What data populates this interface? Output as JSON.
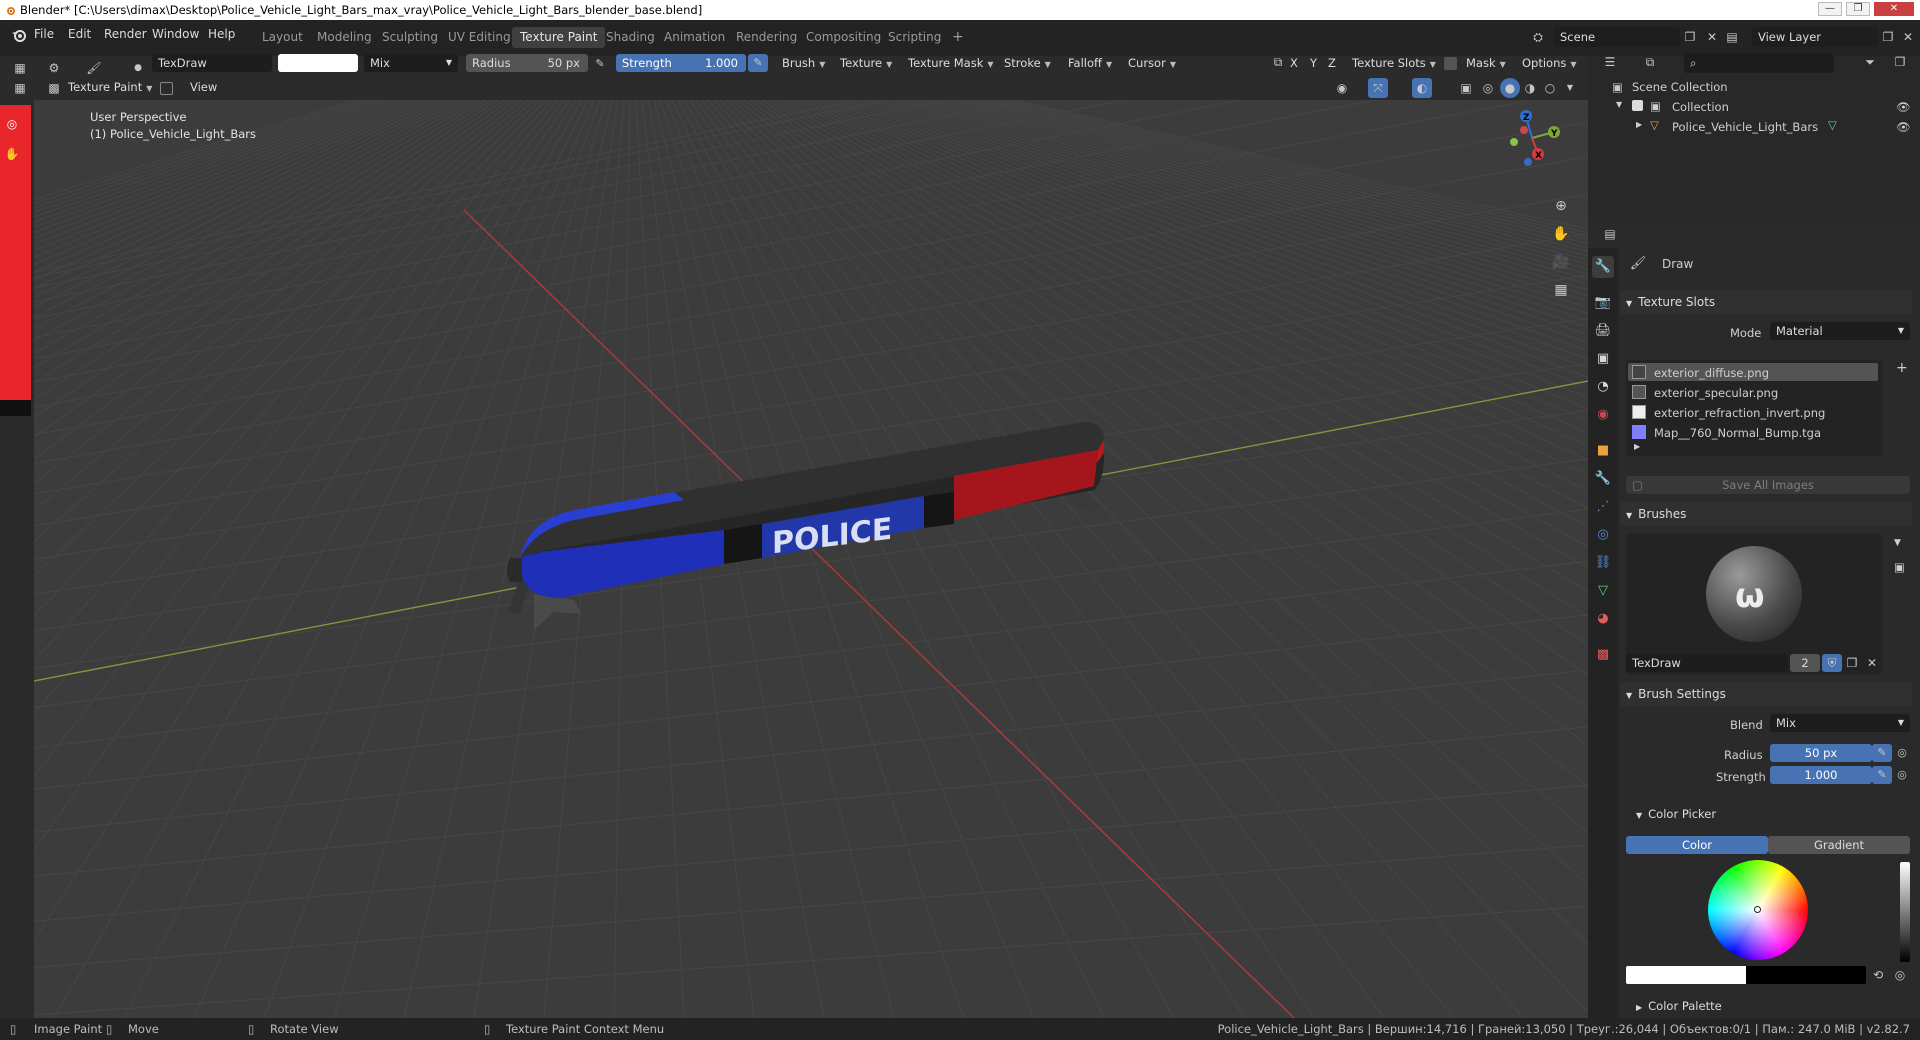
{
  "window": {
    "title": "Blender* [C:\\Users\\dimax\\Desktop\\Police_Vehicle_Light_Bars_max_vray\\Police_Vehicle_Light_Bars_blender_base.blend]"
  },
  "menus": [
    "File",
    "Edit",
    "Render",
    "Window",
    "Help"
  ],
  "workspaces": [
    "Layout",
    "Modeling",
    "Sculpting",
    "UV Editing",
    "Texture Paint",
    "Shading",
    "Animation",
    "Rendering",
    "Compositing",
    "Scripting"
  ],
  "scene": {
    "label": "Scene",
    "view_layer": "View Layer"
  },
  "header": {
    "brush_name": "TexDraw",
    "blend": "Mix",
    "radius_label": "Radius",
    "radius_value": "50 px",
    "strength_label": "Strength",
    "strength_value": "1.000",
    "dropdowns": [
      "Brush",
      "Texture",
      "Texture Mask",
      "Stroke",
      "Falloff",
      "Cursor"
    ],
    "axes": [
      "X",
      "Y",
      "Z"
    ],
    "texture_slots": "Texture Slots",
    "mask": "Mask",
    "options": "Options",
    "mode": "Texture Paint",
    "view": "View"
  },
  "viewport": {
    "perspective": "User Perspective",
    "object": "(1) Police_Vehicle_Light_Bars",
    "decal": "POLICE"
  },
  "gizmo": {
    "x": "X",
    "y": "Y",
    "z": "Z"
  },
  "outliner": {
    "root": "Scene Collection",
    "collection": "Collection",
    "object": "Police_Vehicle_Light_Bars"
  },
  "properties": {
    "tool_name": "Draw",
    "texture_slots": {
      "header": "Texture Slots",
      "mode_label": "Mode",
      "mode_value": "Material",
      "items": [
        "exterior_diffuse.png",
        "exterior_specular.png",
        "exterior_refraction_invert.png",
        "Map__760_Normal_Bump.tga"
      ],
      "save_all": "Save All Images"
    },
    "brushes": {
      "header": "Brushes",
      "name": "TexDraw",
      "users": "2"
    },
    "brush_settings": {
      "header": "Brush Settings",
      "blend_label": "Blend",
      "blend_value": "Mix",
      "radius_label": "Radius",
      "radius_value": "50 px",
      "strength_label": "Strength",
      "strength_value": "1.000"
    },
    "color_picker": {
      "header": "Color Picker",
      "tab_color": "Color",
      "tab_gradient": "Gradient"
    },
    "color_palette": {
      "header": "Color Palette"
    }
  },
  "status": {
    "left": [
      "Image Paint",
      "Move",
      "Rotate View",
      "Texture Paint Context Menu"
    ],
    "right": "Police_Vehicle_Light_Bars | Вершин:14,716 | Граней:13,050 | Треуг.:26,044 | Объектов:0/1 | Пам.: 247.0 MiB | v2.82.7"
  },
  "colors": {
    "accent": "#4772b3",
    "red": "#e8262c",
    "bar_blue": "#1f2fb8",
    "bar_red": "#a5161c"
  }
}
